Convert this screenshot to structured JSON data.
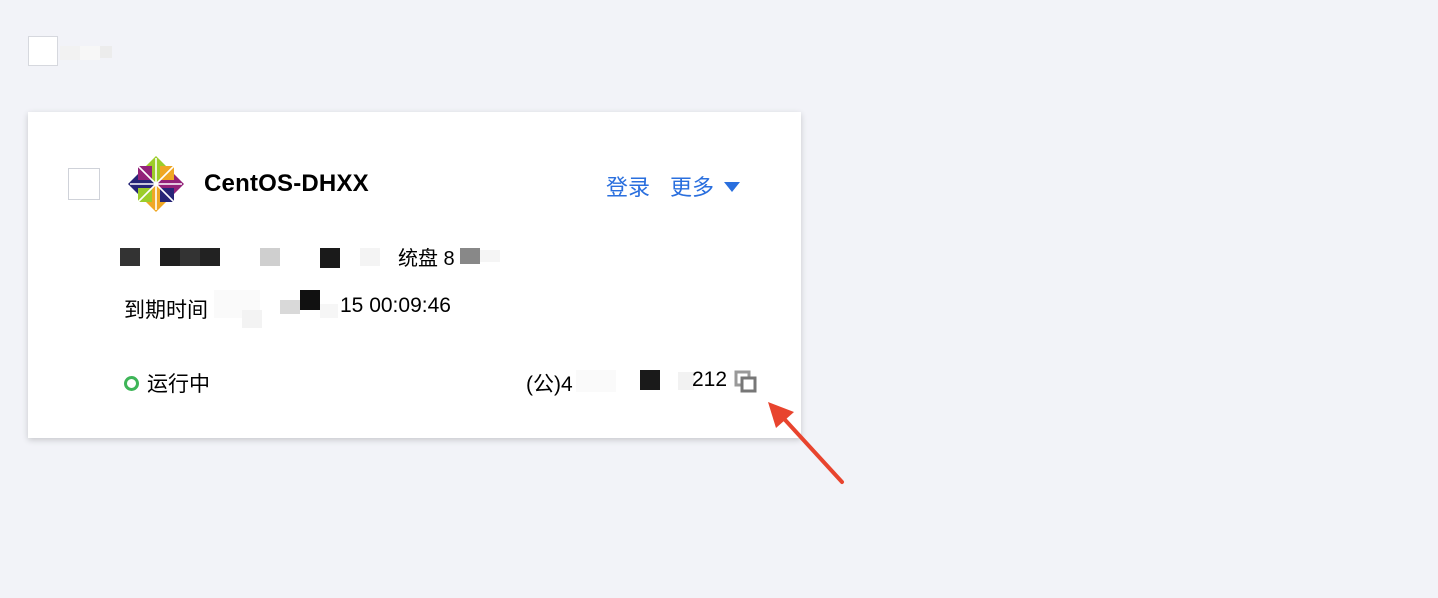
{
  "card": {
    "instance_name": "CentOS-DHXX",
    "login_label": "登录",
    "more_label": "更多",
    "spec_text_fragment": "统盘 8",
    "expire_label": "到期时间",
    "expire_date_fragment": "15 00:09:46",
    "status_label": "运行中",
    "ip_prefix": "(公)4",
    "ip_suffix": "212"
  },
  "colors": {
    "background": "#f2f3f8",
    "link": "#2a6fde",
    "status_running": "#3eb558",
    "annotation_arrow": "#e8442e"
  },
  "icons": {
    "os_logo": "centos-logo-icon",
    "more_caret": "caret-down-icon",
    "status": "status-running-icon",
    "copy": "copy-icon",
    "annotation": "red-arrow-icon"
  }
}
